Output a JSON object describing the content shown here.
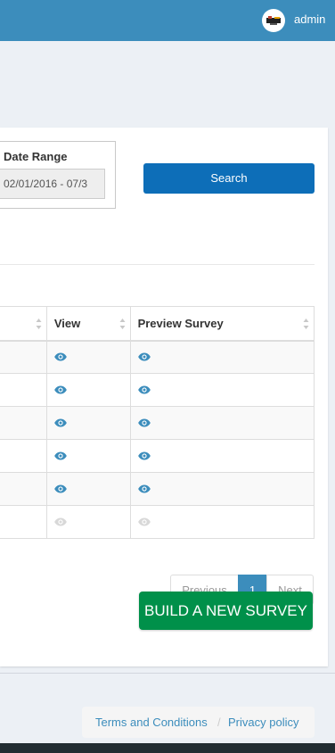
{
  "header": {
    "user_name": "admin",
    "avatar_icon": "logo-avatar-icon",
    "background_color": "#3c8dbc"
  },
  "filters": {
    "date_range_label": "Date Range",
    "date_range_value": "02/01/2016 - 07/3",
    "search_label": "Search"
  },
  "table": {
    "columns": [
      "",
      "View",
      "Preview Survey"
    ],
    "row_count": 6,
    "rows": [
      {
        "view_icon": "eye-icon",
        "preview_icon": "eye-icon",
        "state": "active"
      },
      {
        "view_icon": "eye-icon",
        "preview_icon": "eye-icon",
        "state": "active"
      },
      {
        "view_icon": "eye-icon",
        "preview_icon": "eye-icon",
        "state": "active"
      },
      {
        "view_icon": "eye-icon",
        "preview_icon": "eye-icon",
        "state": "active"
      },
      {
        "view_icon": "eye-icon",
        "preview_icon": "eye-icon",
        "state": "active"
      },
      {
        "view_icon": "eye-icon",
        "preview_icon": "eye-icon",
        "state": "disabled"
      }
    ],
    "icon_color_active": "#3c8dbc",
    "icon_color_disabled": "#d8d8d8"
  },
  "pagination": {
    "previous_label": "Previous",
    "current_page": "1",
    "next_label": "Next"
  },
  "actions": {
    "build_survey_label": "BUILD A NEW SURVEY",
    "build_survey_color": "#00904a"
  },
  "footer": {
    "terms_label": "Terms and Conditions",
    "separator": "/",
    "privacy_label": "Privacy policy"
  }
}
